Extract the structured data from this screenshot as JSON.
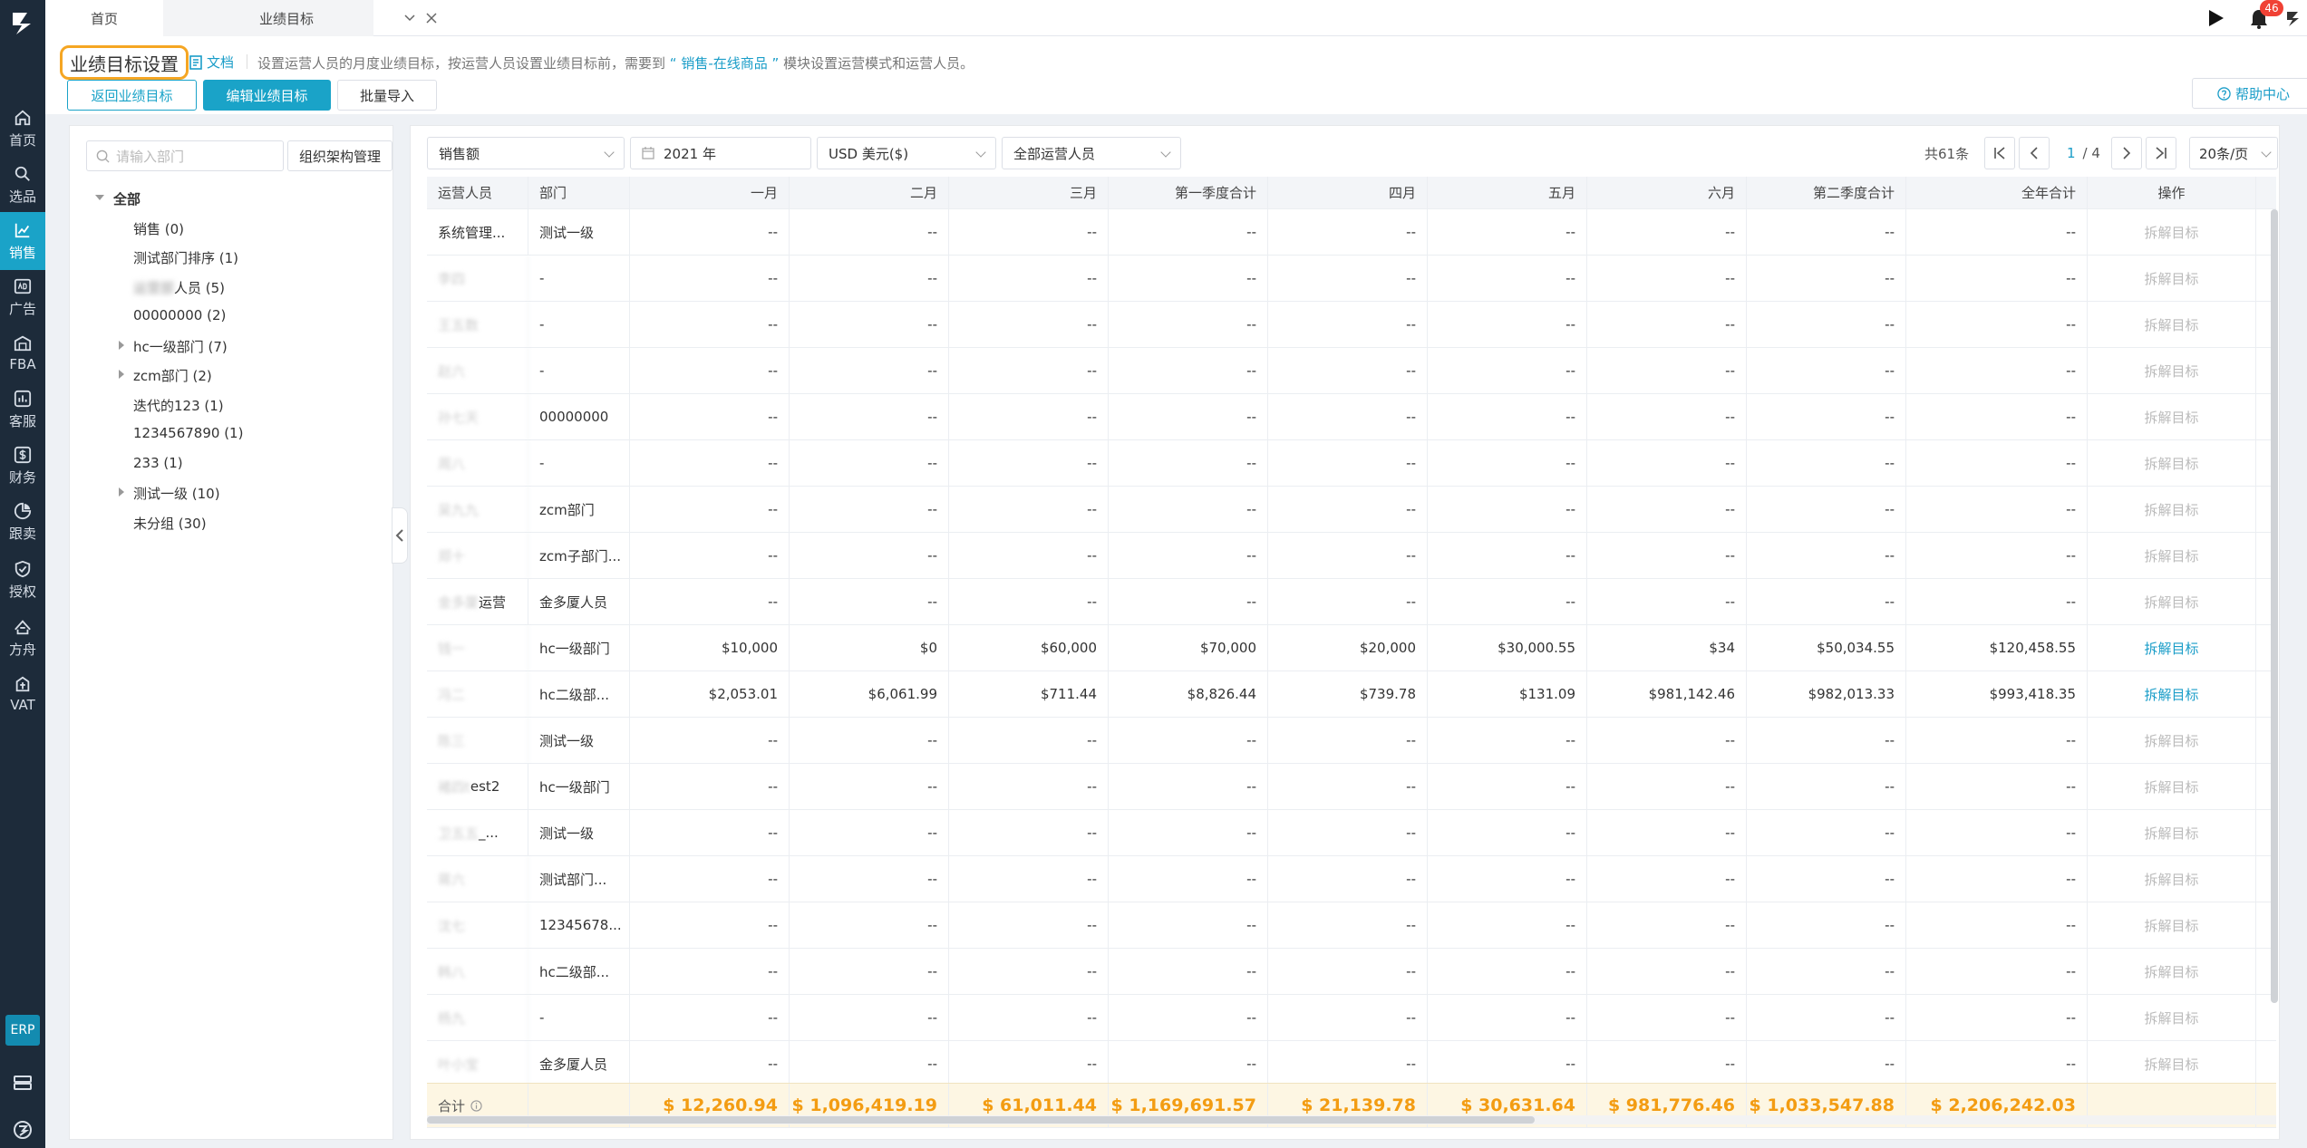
{
  "tabs": {
    "home": "首页",
    "current": "业绩目标"
  },
  "top_right": {
    "notif_count": "46"
  },
  "sidebar": {
    "items": [
      {
        "label": "首页",
        "icon": "home-icon"
      },
      {
        "label": "选品",
        "icon": "search-icon"
      },
      {
        "label": "销售",
        "icon": "chart-icon"
      },
      {
        "label": "广告",
        "icon": "ad-icon"
      },
      {
        "label": "FBA",
        "icon": "warehouse-icon"
      },
      {
        "label": "客服",
        "icon": "support-icon"
      },
      {
        "label": "财务",
        "icon": "dollar-icon"
      },
      {
        "label": "跟卖",
        "icon": "pie-icon"
      },
      {
        "label": "授权",
        "icon": "shield-icon"
      },
      {
        "label": "方舟",
        "icon": "ark-icon"
      },
      {
        "label": "VAT",
        "icon": "vat-icon"
      }
    ],
    "erp": "ERP"
  },
  "header": {
    "title": "业绩目标设置",
    "doc": "文档",
    "desc_pre": "设置运营人员的月度业绩目标，按运营人员设置业绩目标前，需要到",
    "desc_link": "“ 销售-在线商品 ”",
    "desc_post": "模块设置运营模式和运营人员。",
    "back_btn": "返回业绩目标",
    "edit_btn": "编辑业绩目标",
    "import_btn": "批量导入",
    "help_btn": "帮助中心"
  },
  "left": {
    "search_placeholder": "请输入部门",
    "org_btn": "组织架构管理",
    "tree": [
      {
        "label": "全部",
        "bold": true,
        "expand": "down",
        "depth": 0
      },
      {
        "label": "销售  (0)",
        "depth": 1
      },
      {
        "label": "测试部门排序  (1)",
        "depth": 1
      },
      {
        "label": "人员  (5)",
        "depth": 1,
        "blur_prefix": "运营部"
      },
      {
        "label": "00000000  (2)",
        "depth": 1
      },
      {
        "label": "hc一级部门  (7)",
        "depth": 1,
        "expand": "right"
      },
      {
        "label": "zcm部门  (2)",
        "depth": 1,
        "expand": "right"
      },
      {
        "label": "迭代的123  (1)",
        "depth": 1
      },
      {
        "label": "1234567890  (1)",
        "depth": 1
      },
      {
        "label": "233  (1)",
        "depth": 1
      },
      {
        "label": "测试一级  (10)",
        "depth": 1,
        "expand": "right"
      },
      {
        "label": "未分组  (30)",
        "depth": 1
      }
    ]
  },
  "filters": {
    "metric": "销售额",
    "year": "2021 年",
    "currency": "USD  美元($)",
    "operator": "全部运营人员"
  },
  "pager": {
    "total": "共61条",
    "page": "1",
    "pages": "/ 4",
    "size": "20条/页"
  },
  "table": {
    "columns": [
      "运营人员",
      "部门",
      "一月",
      "二月",
      "三月",
      "第一季度合计",
      "四月",
      "五月",
      "六月",
      "第二季度合计",
      "全年合计",
      "操作"
    ],
    "rows": [
      {
        "op": "系统管理...",
        "dept": "测试一级",
        "v": [
          "--",
          "--",
          "--",
          "--",
          "--",
          "--",
          "--",
          "--",
          "--"
        ],
        "action": "拆解目标",
        "active": false
      },
      {
        "op": "李四",
        "op_blur": true,
        "dept": "-",
        "v": [
          "--",
          "--",
          "--",
          "--",
          "--",
          "--",
          "--",
          "--",
          "--"
        ],
        "action": "拆解目标",
        "active": false
      },
      {
        "op": "王五数",
        "op_blur": true,
        "dept": "-",
        "v": [
          "--",
          "--",
          "--",
          "--",
          "--",
          "--",
          "--",
          "--",
          "--"
        ],
        "action": "拆解目标",
        "active": false
      },
      {
        "op": "赵六",
        "op_blur": true,
        "dept": "-",
        "v": [
          "--",
          "--",
          "--",
          "--",
          "--",
          "--",
          "--",
          "--",
          "--"
        ],
        "action": "拆解目标",
        "active": false
      },
      {
        "op": "孙七天",
        "op_blur": true,
        "dept": "00000000",
        "v": [
          "--",
          "--",
          "--",
          "--",
          "--",
          "--",
          "--",
          "--",
          "--"
        ],
        "action": "拆解目标",
        "active": false
      },
      {
        "op": "周八",
        "op_blur": true,
        "dept": "-",
        "v": [
          "--",
          "--",
          "--",
          "--",
          "--",
          "--",
          "--",
          "--",
          "--"
        ],
        "action": "拆解目标",
        "active": false
      },
      {
        "op": "吴九九",
        "op_blur": true,
        "dept": "zcm部门",
        "v": [
          "--",
          "--",
          "--",
          "--",
          "--",
          "--",
          "--",
          "--",
          "--"
        ],
        "action": "拆解目标",
        "active": false
      },
      {
        "op": "郑十",
        "op_blur": true,
        "dept": "zcm子部门...",
        "v": [
          "--",
          "--",
          "--",
          "--",
          "--",
          "--",
          "--",
          "--",
          "--"
        ],
        "action": "拆解目标",
        "active": false
      },
      {
        "op": "运营",
        "op_blur_prefix": "金多厦",
        "dept": "金多厦人员",
        "v": [
          "--",
          "--",
          "--",
          "--",
          "--",
          "--",
          "--",
          "--",
          "--"
        ],
        "action": "拆解目标",
        "active": false
      },
      {
        "op": "钱一",
        "op_blur": true,
        "dept": "hc一级部门",
        "v": [
          "$10,000",
          "$0",
          "$60,000",
          "$70,000",
          "$20,000",
          "$30,000.55",
          "$34",
          "$50,034.55",
          "$120,458.55"
        ],
        "action": "拆解目标",
        "active": true
      },
      {
        "op": "冯二",
        "op_blur": true,
        "dept": "hc二级部...",
        "v": [
          "$2,053.01",
          "$6,061.99",
          "$711.44",
          "$8,826.44",
          "$739.78",
          "$131.09",
          "$981,142.46",
          "$982,013.33",
          "$993,418.35"
        ],
        "action": "拆解目标",
        "active": true
      },
      {
        "op": "陈三",
        "op_blur": true,
        "dept": "测试一级",
        "v": [
          "--",
          "--",
          "--",
          "--",
          "--",
          "--",
          "--",
          "--",
          "--"
        ],
        "action": "拆解目标",
        "active": false
      },
      {
        "op": "est2",
        "op_blur_prefix": "褚四t",
        "dept": "hc一级部门",
        "v": [
          "--",
          "--",
          "--",
          "--",
          "--",
          "--",
          "--",
          "--",
          "--"
        ],
        "action": "拆解目标",
        "active": false
      },
      {
        "op": "_...",
        "op_blur_prefix": "卫五五",
        "dept": "测试一级",
        "v": [
          "--",
          "--",
          "--",
          "--",
          "--",
          "--",
          "--",
          "--",
          "--"
        ],
        "action": "拆解目标",
        "active": false
      },
      {
        "op": "蒋六",
        "op_blur": true,
        "dept": "测试部门...",
        "v": [
          "--",
          "--",
          "--",
          "--",
          "--",
          "--",
          "--",
          "--",
          "--"
        ],
        "action": "拆解目标",
        "active": false
      },
      {
        "op": "沈七",
        "op_blur": true,
        "dept": "12345678...",
        "v": [
          "--",
          "--",
          "--",
          "--",
          "--",
          "--",
          "--",
          "--",
          "--"
        ],
        "action": "拆解目标",
        "active": false
      },
      {
        "op": "韩八",
        "op_blur": true,
        "dept": "hc二级部...",
        "v": [
          "--",
          "--",
          "--",
          "--",
          "--",
          "--",
          "--",
          "--",
          "--"
        ],
        "action": "拆解目标",
        "active": false
      },
      {
        "op": "杨九",
        "op_blur": true,
        "dept": "-",
        "v": [
          "--",
          "--",
          "--",
          "--",
          "--",
          "--",
          "--",
          "--",
          "--"
        ],
        "action": "拆解目标",
        "active": false
      },
      {
        "op": "叶小宝",
        "op_blur": true,
        "dept": "金多厦人员",
        "v": [
          "--",
          "--",
          "--",
          "--",
          "--",
          "--",
          "--",
          "--",
          "--"
        ],
        "action": "拆解目标",
        "active": false
      }
    ],
    "total": {
      "label": "合计",
      "v": [
        "$ 12,260.94",
        "$ 1,096,419.19",
        "$ 61,011.44",
        "$ 1,169,691.57",
        "$ 21,139.78",
        "$ 30,631.64",
        "$ 981,776.46",
        "$ 1,033,547.88",
        "$ 2,206,242.03"
      ]
    }
  }
}
